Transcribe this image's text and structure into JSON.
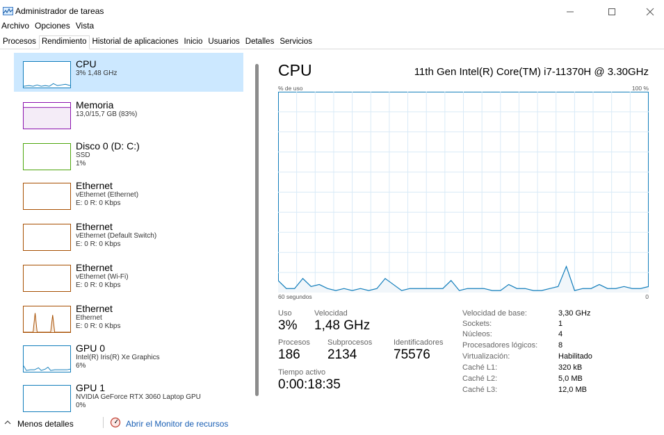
{
  "window": {
    "title": "Administrador de tareas"
  },
  "menu": [
    "Archivo",
    "Opciones",
    "Vista"
  ],
  "tabs": [
    "Procesos",
    "Rendimiento",
    "Historial de aplicaciones",
    "Inicio",
    "Usuarios",
    "Detalles",
    "Servicios"
  ],
  "sidebar": {
    "items": [
      {
        "title": "CPU",
        "lines": [
          "3% 1,48 GHz"
        ],
        "color": "#117dbb"
      },
      {
        "title": "Memoria",
        "lines": [
          "13,0/15,7 GB (83%)"
        ],
        "color": "#8b12ae"
      },
      {
        "title": "Disco 0 (D: C:)",
        "lines": [
          "SSD",
          "1%"
        ],
        "color": "#4da60c"
      },
      {
        "title": "Ethernet",
        "lines": [
          "vEthernet (Ethernet)",
          "E: 0 R: 0 Kbps"
        ],
        "color": "#a74f01"
      },
      {
        "title": "Ethernet",
        "lines": [
          "vEthernet (Default Switch)",
          "E: 0 R: 0 Kbps"
        ],
        "color": "#a74f01"
      },
      {
        "title": "Ethernet",
        "lines": [
          "vEthernet (Wi-Fi)",
          "E: 0 R: 0 Kbps"
        ],
        "color": "#a74f01"
      },
      {
        "title": "Ethernet",
        "lines": [
          "Ethernet",
          "E: 0 R: 0 Kbps"
        ],
        "color": "#a74f01"
      },
      {
        "title": "GPU 0",
        "lines": [
          "Intel(R) Iris(R) Xe Graphics",
          "6%"
        ],
        "color": "#117dbb"
      },
      {
        "title": "GPU 1",
        "lines": [
          "NVIDIA GeForce RTX 3060 Laptop GPU",
          "0%"
        ],
        "color": "#117dbb"
      }
    ]
  },
  "main": {
    "title": "CPU",
    "model": "11th Gen Intel(R) Core(TM) i7-11370H @ 3.30GHz",
    "axis_top_left": "% de uso",
    "axis_top_right": "100 %",
    "axis_bottom_left": "60 segundos",
    "axis_bottom_right": "0",
    "stats": {
      "uso_label": "Uso",
      "uso_value": "3%",
      "velocidad_label": "Velocidad",
      "velocidad_value": "1,48 GHz",
      "procesos_label": "Procesos",
      "procesos_value": "186",
      "subprocesos_label": "Subprocesos",
      "subprocesos_value": "2134",
      "identificadores_label": "Identificadores",
      "identificadores_value": "75576",
      "tiempo_label": "Tiempo activo",
      "tiempo_value": "0:00:18:35"
    },
    "specs": [
      {
        "label": "Velocidad de base:",
        "value": "3,30 GHz"
      },
      {
        "label": "Sockets:",
        "value": "1"
      },
      {
        "label": "Núcleos:",
        "value": "4"
      },
      {
        "label": "Procesadores lógicos:",
        "value": "8"
      },
      {
        "label": "Virtualización:",
        "value": "Habilitado"
      },
      {
        "label": "Caché L1:",
        "value": "320 kB"
      },
      {
        "label": "Caché L2:",
        "value": "5,0 MB"
      },
      {
        "label": "Caché L3:",
        "value": "12,0 MB"
      }
    ]
  },
  "cpu_history": [
    6,
    2,
    2,
    7,
    3,
    4,
    2,
    1,
    2,
    1,
    2,
    1,
    2,
    7,
    4,
    1,
    2,
    2,
    2,
    2,
    2,
    6,
    1,
    2,
    2,
    2,
    1,
    1,
    4,
    2,
    2,
    1,
    1,
    2,
    3,
    13,
    1,
    2,
    2,
    4,
    2,
    2,
    3,
    2,
    2,
    3
  ],
  "colors": {
    "accent": "#117dbb",
    "selected": "#cce8ff",
    "link": "#1a5fb4"
  },
  "footer": {
    "less_details": "Menos detalles",
    "monitor_link": "Abrir el Monitor de recursos"
  }
}
